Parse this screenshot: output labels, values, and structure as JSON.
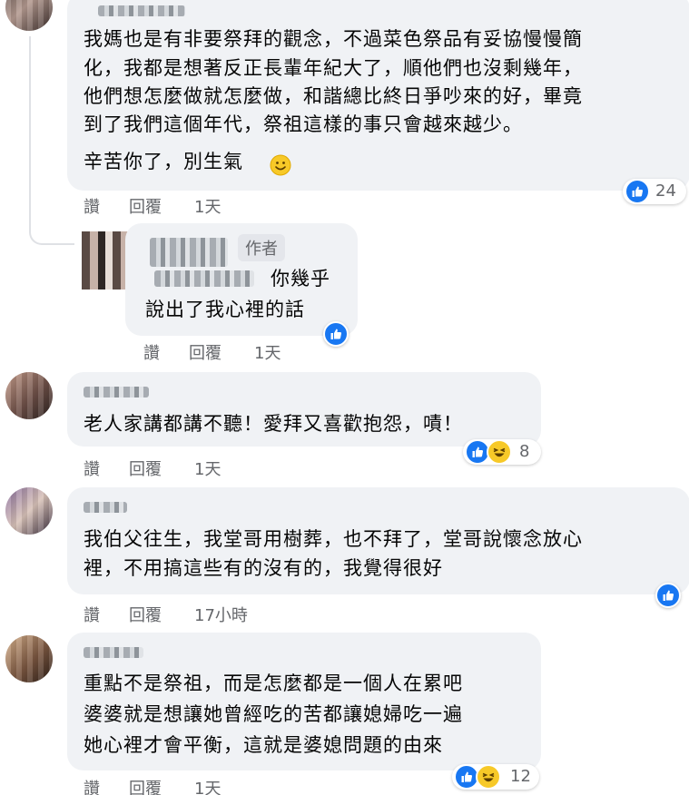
{
  "colors": {
    "bubble": "#f0f2f5",
    "like": "#1877f2",
    "haha": "#f7c928",
    "meta": "#65676b"
  },
  "comments": [
    {
      "lines": [
        "我媽也是有非要祭拜的觀念，不過菜色祭品有妥協慢慢簡",
        "化，我都是想著反正長輩年紀大了，順他們也沒剩幾年，",
        "他們想怎麼做就怎麼做，和諧總比終日爭吵來的好，畢竟",
        "到了我們這個年代，祭祖這樣的事只會越來越少。",
        "辛苦你了，別生氣"
      ],
      "like": "讚",
      "reply": "回覆",
      "time": "1天",
      "reactions": "24"
    },
    {
      "author_tag": "作者",
      "lines": [
        "你幾乎",
        "說出了我心裡的話"
      ],
      "like": "讚",
      "reply": "回覆",
      "time": "1天"
    },
    {
      "lines": [
        "老人家講都講不聽！愛拜又喜歡抱怨，嘖！"
      ],
      "like": "讚",
      "reply": "回覆",
      "time": "1天",
      "reactions": "8"
    },
    {
      "lines": [
        "我伯父往生，我堂哥用樹葬，也不拜了，堂哥說懷念放心",
        "裡，不用搞這些有的沒有的，我覺得很好"
      ],
      "like": "讚",
      "reply": "回覆",
      "time": "17小時"
    },
    {
      "lines": [
        "重點不是祭祖，而是怎麼都是一個人在累吧",
        "婆婆就是想讓她曾經吃的苦都讓媳婦吃一遍",
        "她心裡才會平衡，這就是婆媳問題的由來"
      ],
      "like": "讚",
      "reply": "回覆",
      "time": "1天",
      "reactions": "12"
    }
  ]
}
